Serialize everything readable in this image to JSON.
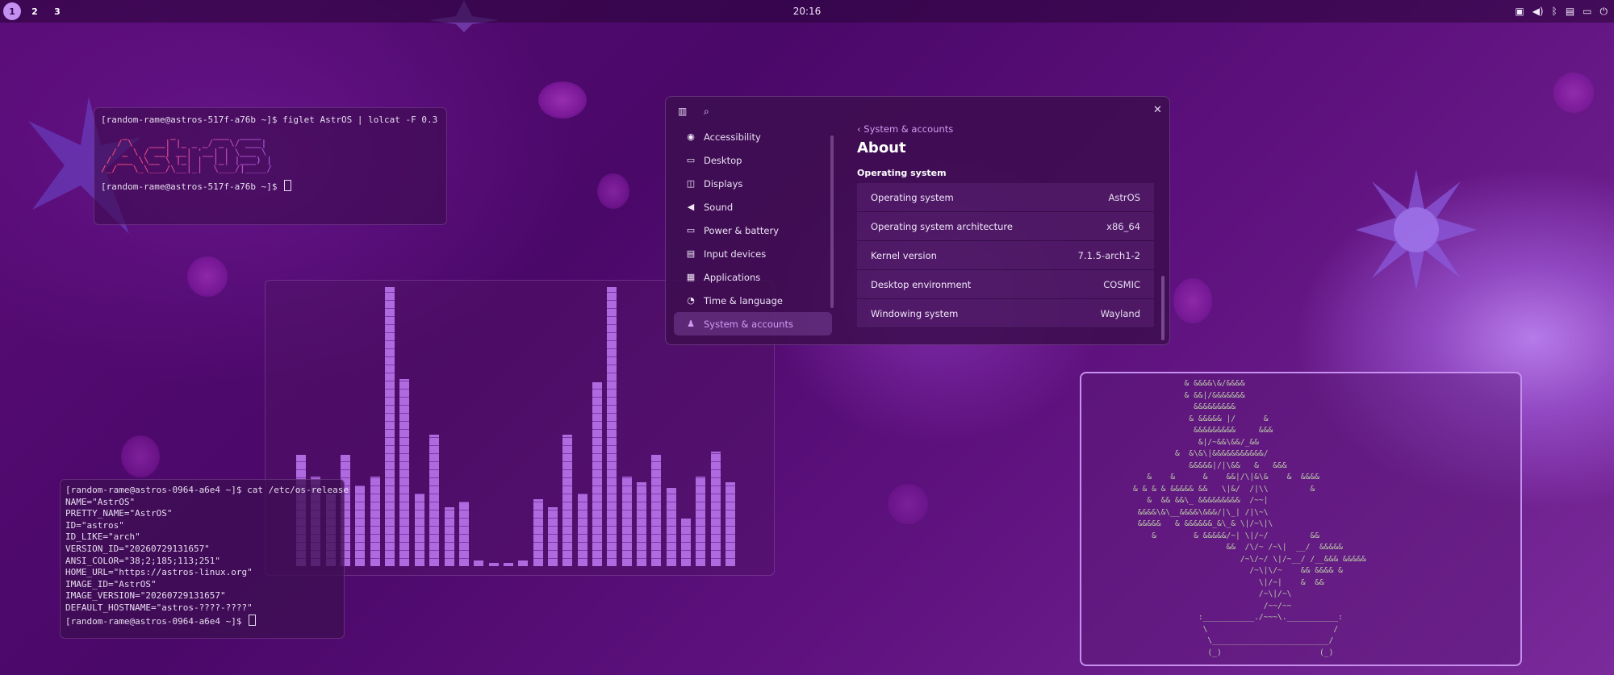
{
  "panel": {
    "workspaces": [
      "1",
      "2",
      "3"
    ],
    "clock": "20:16",
    "tray_icons": [
      "screen-share-icon",
      "volume-icon",
      "bluetooth-icon",
      "calendar-icon",
      "notifications-icon",
      "power-icon"
    ]
  },
  "term1": {
    "lines": [
      "[random-rame@astros-517f-a76b ~]$ figlet AstrOS | lolcat -F 0.3",
      "[random-rame@astros-517f-a76b ~]$ "
    ],
    "logo": "    _        _       ___  ____  \n   / \\   ___| |_ _ _/ _ \\/ ___| \n  / _ \\ / __| __| '__| | \\___ \\ \n / ___ \\\\__ \\ |_| |  |_| |___) |\n/_/   \\_\\___/\\__|_|  \\___/|____/ "
  },
  "term2": {
    "lines": [
      "[random-rame@astros-0964-a6e4 ~]$ cat /etc/os-release",
      "NAME=\"AstrOS\"",
      "PRETTY_NAME=\"AstrOS\"",
      "ID=\"astros\"",
      "ID_LIKE=\"arch\"",
      "VERSION_ID=\"20260729131657\"",
      "ANSI_COLOR=\"38;2;185;113;251\"",
      "HOME_URL=\"https://astros-linux.org\"",
      "IMAGE_ID=\"AstrOS\"",
      "IMAGE_VERSION=\"20260729131657\"",
      "DEFAULT_HOSTNAME=\"astros-????-????\"",
      "[random-rame@astros-0964-a6e4 ~]$ "
    ]
  },
  "settings": {
    "sidebar": [
      {
        "label": "Accessibility",
        "icon": "accessibility-icon",
        "glyph": "◉"
      },
      {
        "label": "Desktop",
        "icon": "desktop-icon",
        "glyph": "▭"
      },
      {
        "label": "Displays",
        "icon": "displays-icon",
        "glyph": "◫"
      },
      {
        "label": "Sound",
        "icon": "sound-icon",
        "glyph": "◀"
      },
      {
        "label": "Power & battery",
        "icon": "battery-icon",
        "glyph": "▭"
      },
      {
        "label": "Input devices",
        "icon": "keyboard-icon",
        "glyph": "▤"
      },
      {
        "label": "Applications",
        "icon": "apps-icon",
        "glyph": "▦"
      },
      {
        "label": "Time & language",
        "icon": "time-icon",
        "glyph": "◔"
      },
      {
        "label": "System & accounts",
        "icon": "accounts-icon",
        "glyph": "♟"
      }
    ],
    "breadcrumb": "System & accounts",
    "title": "About",
    "section": "Operating system",
    "rows": [
      {
        "label": "Operating system",
        "value": "AstrOS"
      },
      {
        "label": "Operating system architecture",
        "value": "x86_64"
      },
      {
        "label": "Kernel version",
        "value": "7.1.5-arch1-2"
      },
      {
        "label": "Desktop environment",
        "value": "COSMIC"
      },
      {
        "label": "Windowing system",
        "value": "Wayland"
      }
    ]
  },
  "visualizer": {
    "levels": [
      0.4,
      0.32,
      0.26,
      0.4,
      0.29,
      0.32,
      1.0,
      0.67,
      0.26,
      0.47,
      0.21,
      0.23,
      0.02,
      0.01,
      0.01,
      0.02,
      0.24,
      0.21,
      0.47,
      0.26,
      0.66,
      1.0,
      0.32,
      0.3,
      0.4,
      0.28,
      0.17,
      0.32,
      0.41,
      0.3
    ],
    "color": "#b06ae0"
  },
  "ascii_art": {
    "lines": [
      "                    & &&&&\\&/&&&&",
      "                    & &&|/&&&&&&&",
      "                      &&&&&&&&&",
      "                     & &&&&& |/      &",
      "                      &&&&&&&&&     &&&",
      "                       &|/~&&\\&&/_&&",
      "                  &  &\\&\\|&&&&&&&&&&&/",
      "                     &&&&&|/|\\&&   &   &&&",
      "            &    &      &    &&|/\\|&\\&    &  &&&&",
      "         & & & & &&&&& &&   \\|&/  /|\\\\         &",
      "            &  && &&\\_ &&&&&&&&&  /~~|",
      "          &&&&\\&\\__&&&&\\&&&/|\\_| /|\\~\\",
      "          &&&&&   & &&&&&&_&\\_& \\|/~\\|\\",
      "             &        & &&&&&/~| \\|/~/         &&",
      "                             &&  /\\/~ /~\\|  __/  &&&&&",
      "                                /~\\/~/ \\|/~__/ /__&&& &&&&&",
      "                                  /~\\|\\/~    && &&&& &",
      "                                    \\|/~|    &  &&",
      "                                    /~\\|/~\\",
      "                                     /~~/~~",
      "                       :___________./~~~\\.___________:",
      "                        \\                           /",
      "                         \\_________________________/",
      "                         (_)                     (_)"
    ]
  }
}
